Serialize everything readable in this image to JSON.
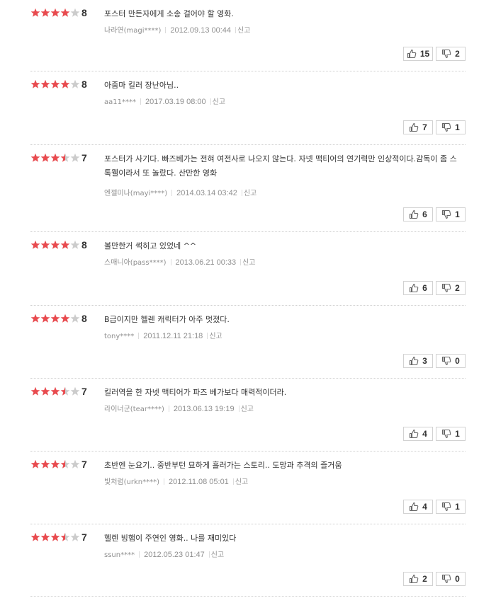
{
  "colors": {
    "star_on": "#e84b4f",
    "star_off": "#cccccc"
  },
  "reviews": [
    {
      "rating": 4,
      "score": "8",
      "text": "포스터 만든자에게 소송 걸어야 할 영화.",
      "nick": "나라연(magi****)",
      "date": "2012.09.13 00:44",
      "report": "신고",
      "likes": "15",
      "dislikes": "2"
    },
    {
      "rating": 4,
      "score": "8",
      "text": "아줌마 킬러 장난아님..",
      "nick": "aa11****",
      "date": "2017.03.19 08:00",
      "report": "신고",
      "likes": "7",
      "dislikes": "1"
    },
    {
      "rating": 3.5,
      "score": "7",
      "text": "포스터가 사기다. 빠즈베가는 전혀 여전사로 나오지 않는다. 자넷 맥티어의 연기력만 인상적이다.감독이 좀 스톡웰이라서 또 놀랐다. 산만한 영화",
      "nick": "엔젤미나(mayi****)",
      "date": "2014.03.14 03:42",
      "report": "신고",
      "likes": "6",
      "dislikes": "1"
    },
    {
      "rating": 4,
      "score": "8",
      "text": "볼만한거 썩히고 있었네 ^^",
      "nick": "스매니아(pass****)",
      "date": "2013.06.21 00:33",
      "report": "신고",
      "likes": "6",
      "dislikes": "2"
    },
    {
      "rating": 4,
      "score": "8",
      "text": "B급이지만 헬렌 캐릭터가 아주 멋졌다.",
      "nick": "tony****",
      "date": "2011.12.11 21:18",
      "report": "신고",
      "likes": "3",
      "dislikes": "0"
    },
    {
      "rating": 3.5,
      "score": "7",
      "text": "킬러역을 한 자넷 맥티어가 파즈 베가보다 매력적이더라.",
      "nick": "라이너군(tear****)",
      "date": "2013.06.13 19:19",
      "report": "신고",
      "likes": "4",
      "dislikes": "1"
    },
    {
      "rating": 3.5,
      "score": "7",
      "text": "초반엔 눈요기.. 중반부턴 묘하게 흘러가는 스토리.. 도망과 추격의 즐거움",
      "nick": "빛처럼(urkn****)",
      "date": "2012.11.08 05:01",
      "report": "신고",
      "likes": "4",
      "dislikes": "1"
    },
    {
      "rating": 3.5,
      "score": "7",
      "text": "헬렌 빙햄이 주연인 영화.. 나를 재미있다",
      "nick": "ssun****",
      "date": "2012.05.23 01:47",
      "report": "신고",
      "likes": "2",
      "dislikes": "0"
    }
  ]
}
